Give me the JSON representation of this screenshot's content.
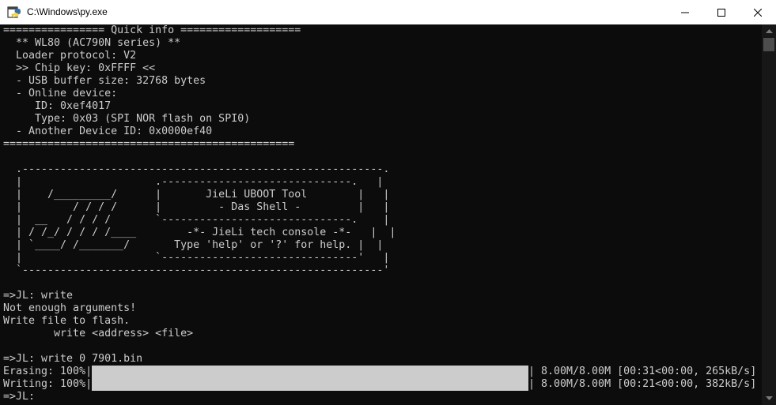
{
  "window": {
    "title": "C:\\Windows\\py.exe"
  },
  "colors": {
    "console_bg": "#0c0c0c",
    "console_text": "#cccccc",
    "progress_fill": "#cccccc",
    "titlebar_bg": "#ffffff"
  },
  "console": {
    "lines": [
      "================ Quick info ===================",
      "  ** WL80 (AC790N series) **",
      "  Loader protocol: V2",
      "  >> Chip key: 0xFFFF <<",
      "  - USB buffer size: 32768 bytes",
      "  - Online device:",
      "     ID: 0xef4017",
      "     Type: 0x03 (SPI NOR flash on SPI0)",
      "  - Another Device ID: 0x0000ef40",
      "==============================================",
      "",
      "  .---------------------------------------------------------.",
      "  |                     .------------------------------.   |",
      "  |    /_________/      |       JieLi UBOOT Tool        |   |",
      "  |        / / / /      |         - Das Shell -         |   |",
      "  |  __   / / / /       `------------------------------.    |",
      "  | / /_/ / / / /____        -*- JieLi tech console -*-   |  |",
      "  | `____/ /_______/       Type 'help' or '?' for help. |  |",
      "  |                     `-------------------------------'   |",
      "  `---------------------------------------------------------'",
      "",
      "=>JL: write",
      "Not enough arguments!",
      "Write file to flash.",
      "        write <address> <file>",
      "",
      "=>JL: write 0 7901.bin",
      "Erasing: 100%|",
      "Writing: 100%|",
      "=>JL:"
    ],
    "progress": [
      {
        "label": "Erasing: 100%|",
        "percent": 100,
        "stats": "| 8.00M/8.00M [00:31<00:00, 265kB/s]"
      },
      {
        "label": "Writing: 100%|",
        "percent": 100,
        "stats": "| 8.00M/8.00M [00:21<00:00, 382kB/s]"
      }
    ]
  }
}
